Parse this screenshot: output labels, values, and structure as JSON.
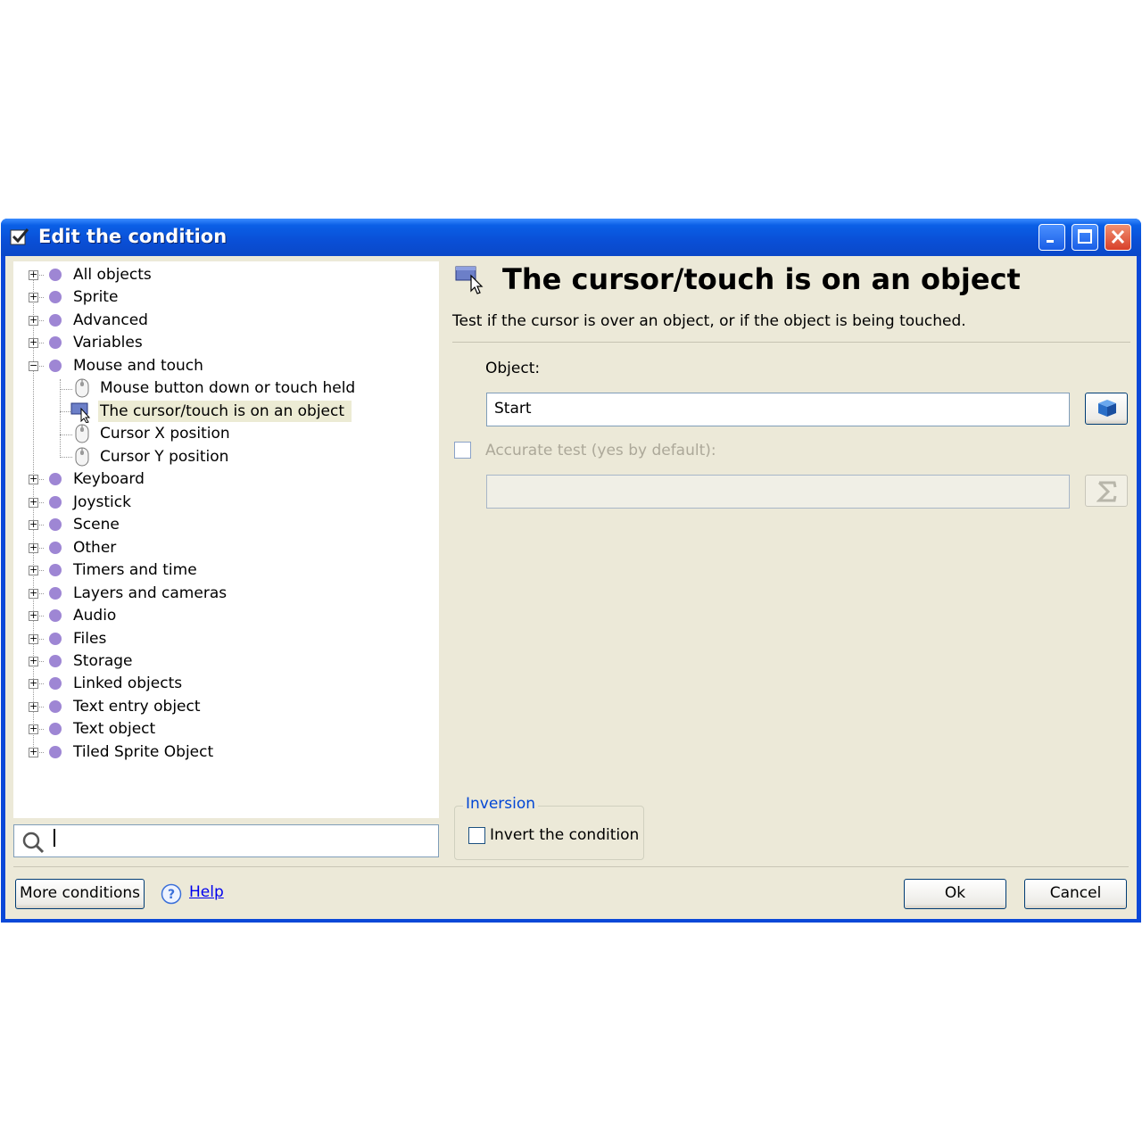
{
  "window": {
    "title": "Edit the condition"
  },
  "tree": {
    "items": [
      {
        "label": "All objects",
        "expander": "+"
      },
      {
        "label": "Sprite",
        "expander": "+"
      },
      {
        "label": "Advanced",
        "expander": "+"
      },
      {
        "label": "Variables",
        "expander": "+"
      },
      {
        "label": "Mouse and touch",
        "expander": "−"
      },
      {
        "label": "Mouse button down or touch held"
      },
      {
        "label": "The cursor/touch is on an object"
      },
      {
        "label": "Cursor X position"
      },
      {
        "label": "Cursor Y position"
      },
      {
        "label": "Keyboard",
        "expander": "+"
      },
      {
        "label": "Joystick",
        "expander": "+"
      },
      {
        "label": "Scene",
        "expander": "+"
      },
      {
        "label": "Other",
        "expander": "+"
      },
      {
        "label": "Timers and time",
        "expander": "+"
      },
      {
        "label": "Layers and cameras",
        "expander": "+"
      },
      {
        "label": "Audio",
        "expander": "+"
      },
      {
        "label": "Files",
        "expander": "+"
      },
      {
        "label": "Storage",
        "expander": "+"
      },
      {
        "label": "Linked objects",
        "expander": "+"
      },
      {
        "label": "Text entry object",
        "expander": "+"
      },
      {
        "label": "Text object",
        "expander": "+"
      },
      {
        "label": "Tiled Sprite Object",
        "expander": "+"
      }
    ],
    "selected": "The cursor/touch is on an object"
  },
  "search": {
    "value": ""
  },
  "condition": {
    "title": "The cursor/touch is on an object",
    "description": "Test if the cursor is over an object, or if the object is being touched.",
    "object_label": "Object:",
    "object_value": "Start",
    "accurate_label": "Accurate test (yes by default):",
    "accurate_value": ""
  },
  "inversion": {
    "group_title": "Inversion",
    "checkbox_label": "Invert the condition"
  },
  "footer": {
    "more_conditions": "More conditions",
    "help": "Help",
    "ok": "Ok",
    "cancel": "Cancel"
  },
  "colors": {
    "title_bar": "#0a48d8",
    "category_dot": "#9e86d4",
    "selected_row": "#ecebd4",
    "inversion_title": "#0046d5"
  },
  "icons": {
    "window": "checkbox-icon",
    "category": "circle-bullet-icon",
    "mouse": "mouse-icon",
    "cursor_object": "cursor-over-object-icon",
    "search": "search-icon",
    "object_picker": "object-picker-icon",
    "expression": "sigma-icon",
    "help": "help-icon"
  }
}
